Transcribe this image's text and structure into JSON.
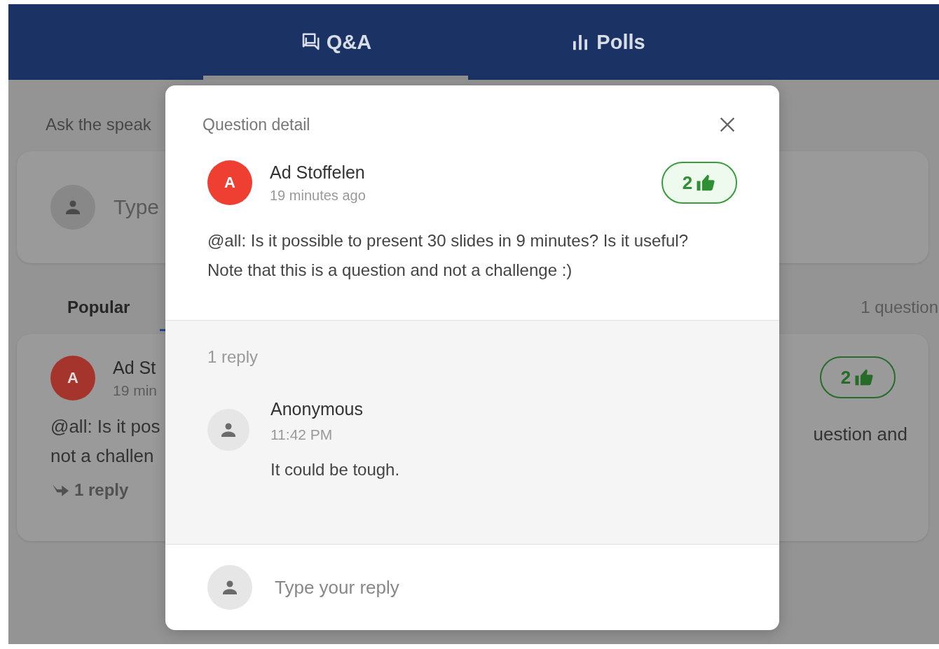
{
  "tabs": [
    {
      "label": "Q&A",
      "kind": "chat",
      "selected": true
    },
    {
      "label": "Polls",
      "kind": "bars",
      "selected": false
    }
  ],
  "background": {
    "prompt": "Ask the speak",
    "input_placeholder": "Type",
    "sort_tabs": [
      {
        "label": "Popular"
      }
    ],
    "count": "1 question",
    "question": {
      "initial": "A",
      "author": "Ad St",
      "time": "19 min",
      "text_lines": [
        "@all: Is it pos",
        "not a challen"
      ],
      "text_right": "uestion and",
      "votes": "2",
      "replies": "1 reply"
    }
  },
  "dialog": {
    "title": "Question detail",
    "question": {
      "initial": "A",
      "author": "Ad Stoffelen",
      "time": "19 minutes ago",
      "votes": "2",
      "text": "@all: Is it possible to present 30 slides in 9 minutes? Is it useful? Note that this is a question and not a challenge :)"
    },
    "replies_count": "1 reply",
    "replies": [
      {
        "author": "Anonymous",
        "time": "11:42 PM",
        "text": "It could be tough."
      }
    ],
    "reply_input": {
      "placeholder": "Type your reply"
    }
  }
}
